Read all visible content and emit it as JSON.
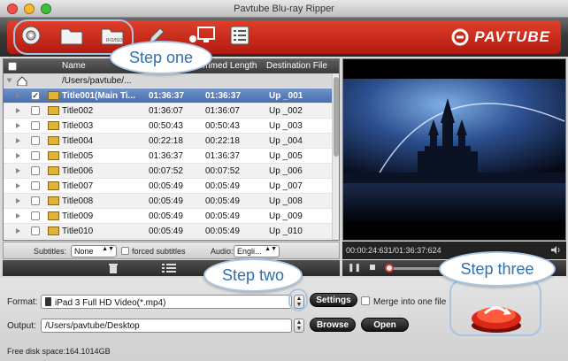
{
  "window": {
    "title": "Pavtube Blu-ray Ripper"
  },
  "toolbar": {
    "buttons": [
      {
        "icon": "disc-load-icon"
      },
      {
        "icon": "folder-icon"
      },
      {
        "icon": "ifo-folder-icon",
        "label": "IFO/ISO"
      },
      {
        "icon": "edit-pencil-icon"
      },
      {
        "icon": "merge-monitor-icon"
      },
      {
        "icon": "task-list-icon"
      }
    ],
    "brand": "PAVTUBE"
  },
  "callouts": {
    "step1": "Step one",
    "step2": "Step two",
    "step3": "Step three"
  },
  "table": {
    "columns": [
      "Name",
      "Trimmed Length",
      "Destination File"
    ],
    "path": "/Users/pavtube/...",
    "rows": [
      {
        "name": "Title001(Main Ti...",
        "duration": "01:36:37",
        "trimmed": "01:36:37",
        "dest": "Up _001",
        "checked": true,
        "selected": true
      },
      {
        "name": "Title002",
        "duration": "01:36:07",
        "trimmed": "01:36:07",
        "dest": "Up _002",
        "checked": false,
        "selected": false
      },
      {
        "name": "Title003",
        "duration": "00:50:43",
        "trimmed": "00:50:43",
        "dest": "Up _003",
        "checked": false,
        "selected": false
      },
      {
        "name": "Title004",
        "duration": "00:22:18",
        "trimmed": "00:22:18",
        "dest": "Up _004",
        "checked": false,
        "selected": false
      },
      {
        "name": "Title005",
        "duration": "01:36:37",
        "trimmed": "01:36:37",
        "dest": "Up _005",
        "checked": false,
        "selected": false
      },
      {
        "name": "Title006",
        "duration": "00:07:52",
        "trimmed": "00:07:52",
        "dest": "Up _006",
        "checked": false,
        "selected": false
      },
      {
        "name": "Title007",
        "duration": "00:05:49",
        "trimmed": "00:05:49",
        "dest": "Up _007",
        "checked": false,
        "selected": false
      },
      {
        "name": "Title008",
        "duration": "00:05:49",
        "trimmed": "00:05:49",
        "dest": "Up _008",
        "checked": false,
        "selected": false
      },
      {
        "name": "Title009",
        "duration": "00:05:49",
        "trimmed": "00:05:49",
        "dest": "Up _009",
        "checked": false,
        "selected": false
      },
      {
        "name": "Title010",
        "duration": "00:05:49",
        "trimmed": "00:05:49",
        "dest": "Up _010",
        "checked": false,
        "selected": false
      }
    ]
  },
  "subtitles": {
    "label": "Subtitles:",
    "value": "None",
    "forced_label": "forced subtitles",
    "audio_label": "Audio:",
    "audio_value": "Engli..."
  },
  "preview": {
    "time": "00:00:24:631/01:36:37:624"
  },
  "format": {
    "label": "Format:",
    "value": "iPad 3 Full HD Video(*.mp4)",
    "settings": "Settings",
    "merge_label": "Merge into one file"
  },
  "output": {
    "label": "Output:",
    "value": "/Users/pavtube/Desktop",
    "browse": "Browse",
    "open": "Open"
  },
  "disk": {
    "text": "Free disk space:164.1014GB"
  },
  "colors": {
    "accent_red": "#c42a17",
    "callout_blue": "#2f6fb0",
    "selection": "#476fb0"
  }
}
